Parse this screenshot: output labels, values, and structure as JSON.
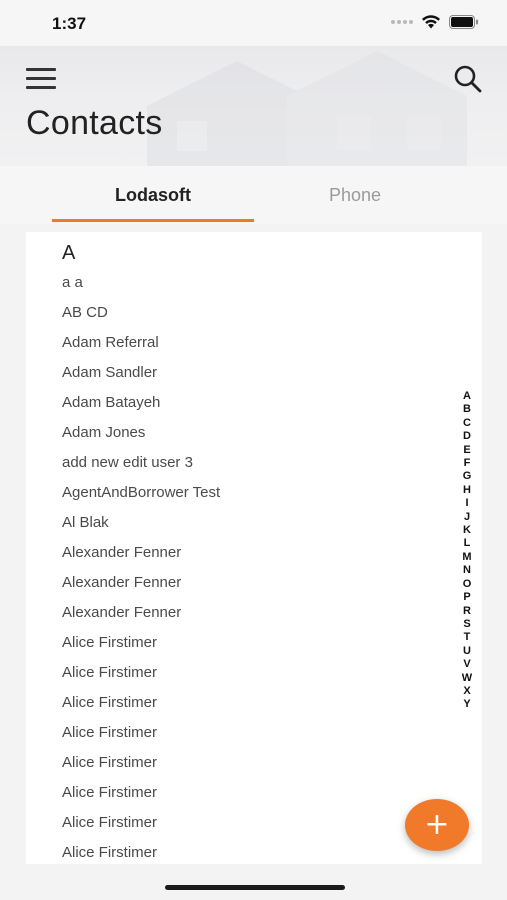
{
  "status_bar": {
    "time": "1:37",
    "icons": [
      "signal-icon",
      "wifi-icon",
      "battery-icon"
    ]
  },
  "header": {
    "title": "Contacts",
    "menu_icon": "hamburger-menu-icon",
    "search_icon": "search-icon"
  },
  "tabs": [
    {
      "label": "Lodasoft",
      "active": true
    },
    {
      "label": "Phone",
      "active": false
    }
  ],
  "contacts": {
    "section": "A",
    "items": [
      "a a",
      "AB CD",
      "Adam Referral",
      "Adam Sandler",
      "Adam Batayeh",
      "Adam Jones",
      "add new edit user 3",
      "AgentAndBorrower Test",
      "Al Blak",
      "Alexander Fenner",
      "Alexander Fenner",
      "Alexander Fenner",
      "Alice Firstimer",
      "Alice Firstimer",
      "Alice Firstimer",
      "Alice Firstimer",
      "Alice Firstimer",
      "Alice Firstimer",
      "Alice Firstimer",
      "Alice Firstimer"
    ]
  },
  "alphabet_index": [
    "A",
    "B",
    "C",
    "D",
    "E",
    "F",
    "G",
    "H",
    "I",
    "J",
    "K",
    "L",
    "M",
    "N",
    "O",
    "P",
    "R",
    "S",
    "T",
    "U",
    "V",
    "W",
    "X",
    "Y"
  ],
  "fab": {
    "label": "+",
    "icon": "plus-icon"
  },
  "colors": {
    "accent": "#f07a2a",
    "background": "#f3f3f3",
    "card": "#ffffff",
    "inactive_tab": "#9a9a9a"
  }
}
